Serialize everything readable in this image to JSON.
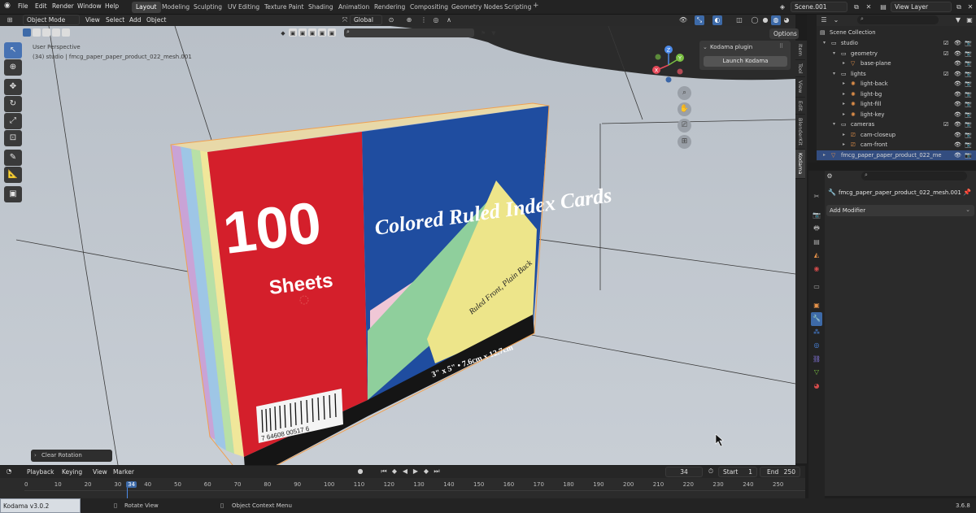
{
  "menu": {
    "file": "File",
    "edit": "Edit",
    "render": "Render",
    "window": "Window",
    "help": "Help"
  },
  "workspaces": [
    "Layout",
    "Modeling",
    "Sculpting",
    "UV Editing",
    "Texture Paint",
    "Shading",
    "Animation",
    "Rendering",
    "Compositing",
    "Geometry Nodes",
    "Scripting"
  ],
  "scene_name": "Scene.001",
  "view_layer": "View Layer",
  "viewport": {
    "mode": "Object Mode",
    "menu": [
      "View",
      "Select",
      "Add",
      "Object"
    ],
    "orientation": "Global",
    "options": "Options",
    "perspective": "User Perspective",
    "object_info": "(34) studio | fmcg_paper_paper_product_022_mesh.001",
    "last_op": "Clear Rotation"
  },
  "kodama": {
    "title": "Kodama plugin",
    "button": "Launch Kodama"
  },
  "ntabs": [
    "Item",
    "Tool",
    "View",
    "Edit",
    "BlenderKit",
    "Kodama"
  ],
  "gizmo": {
    "x": "X",
    "y": "Y",
    "z": "Z"
  },
  "box": {
    "big": "100",
    "sheets": "Sheets",
    "title": "Colored Ruled Index Cards",
    "sub": "Ruled Front, Plain Back",
    "size": "3\" x 5\" • 7.6cm x 12.7cm",
    "barcode": "7 64608 00517 6"
  },
  "outliner": {
    "root": "Scene Collection",
    "rows": [
      {
        "label": "studio",
        "depth": 0,
        "kind": "collection"
      },
      {
        "label": "geometry",
        "depth": 1,
        "kind": "collection"
      },
      {
        "label": "base-plane",
        "depth": 2,
        "kind": "mesh"
      },
      {
        "label": "lights",
        "depth": 1,
        "kind": "collection"
      },
      {
        "label": "light-back",
        "depth": 2,
        "kind": "light"
      },
      {
        "label": "light-bg",
        "depth": 2,
        "kind": "light"
      },
      {
        "label": "light-fill",
        "depth": 2,
        "kind": "light"
      },
      {
        "label": "light-key",
        "depth": 2,
        "kind": "light"
      },
      {
        "label": "cameras",
        "depth": 1,
        "kind": "collection"
      },
      {
        "label": "cam-closeup",
        "depth": 2,
        "kind": "camera"
      },
      {
        "label": "cam-front",
        "depth": 2,
        "kind": "camera"
      },
      {
        "label": "fmcg_paper_paper_product_022_me",
        "depth": 0,
        "kind": "object"
      }
    ]
  },
  "properties": {
    "object": "fmcg_paper_paper_product_022_mesh.001",
    "add_modifier": "Add Modifier"
  },
  "timeline": {
    "menus": [
      "Playback",
      "Keying",
      "View",
      "Marker"
    ],
    "current": "34",
    "start_label": "Start",
    "start": "1",
    "end_label": "End",
    "end": "250",
    "ticks": [
      "0",
      "10",
      "20",
      "30",
      "34",
      "40",
      "50",
      "60",
      "70",
      "80",
      "90",
      "100",
      "110",
      "120",
      "130",
      "140",
      "150",
      "160",
      "170",
      "180",
      "190",
      "200",
      "210",
      "220",
      "230",
      "240",
      "250"
    ]
  },
  "status": {
    "left": "Kodama v3.0.2",
    "rotate": "Rotate View",
    "context": "Object Context Menu",
    "version": "3.6.8"
  }
}
